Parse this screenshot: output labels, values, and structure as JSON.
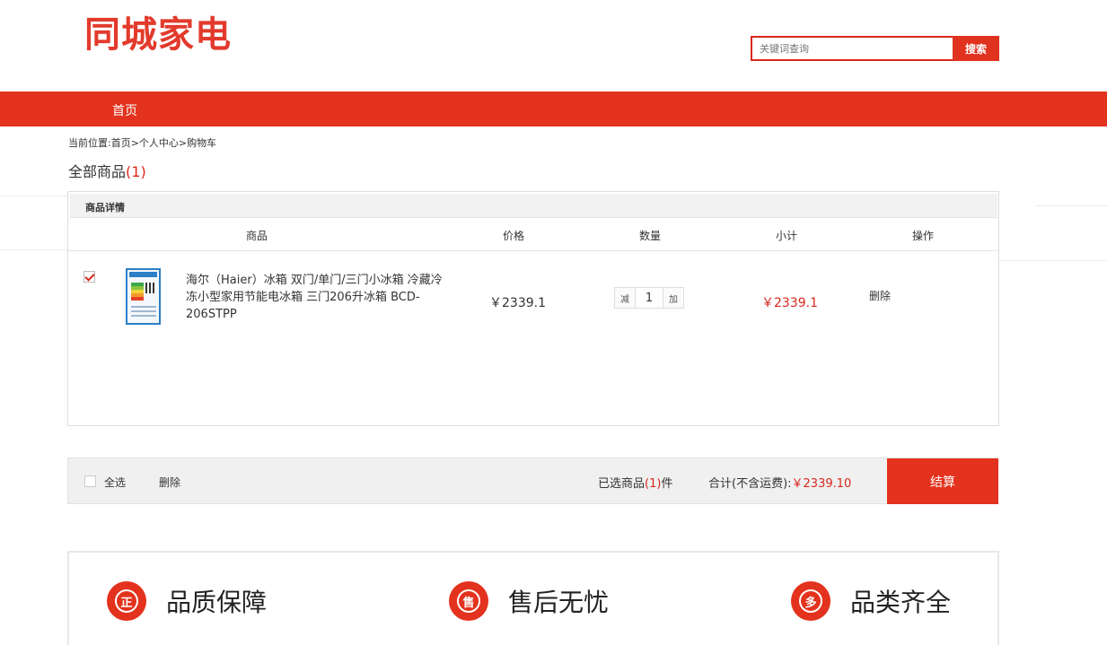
{
  "header": {
    "logo": "同城家电",
    "search": {
      "placeholder": "关键词查询",
      "button": "搜索"
    }
  },
  "nav": {
    "home": "首页"
  },
  "breadcrumb": "当前位置:首页>个人中心>购物车",
  "cart": {
    "title": "全部商品",
    "count": "(1)",
    "section_title": "商品详情",
    "columns": [
      "商品",
      "价格",
      "数量",
      "小计",
      "操作"
    ],
    "items": [
      {
        "checked": true,
        "name": "海尔（Haier）冰箱 双门/单门/三门小冰箱 冷藏冷冻小型家用节能电冰箱 三门206升冰箱 BCD-206STPP",
        "price": "￥2339.1",
        "qty_minus": "减",
        "qty": "1",
        "qty_plus": "加",
        "subtotal": "￥2339.1",
        "action": "删除"
      }
    ]
  },
  "footer_bar": {
    "select_all": "全选",
    "delete": "删除",
    "selected_prefix": "已选商品",
    "selected_count": "(1)",
    "selected_suffix": "件",
    "total_label": "合计(不含运费):",
    "total_amount": "￥2339.10",
    "checkout": "结算"
  },
  "promises": [
    {
      "icon": "正",
      "label": "品质保障"
    },
    {
      "icon": "售",
      "label": "售后无忧"
    },
    {
      "icon": "多",
      "label": "品类齐全"
    }
  ],
  "colors": {
    "brand": "#e3321d",
    "price": "#d8281c"
  }
}
